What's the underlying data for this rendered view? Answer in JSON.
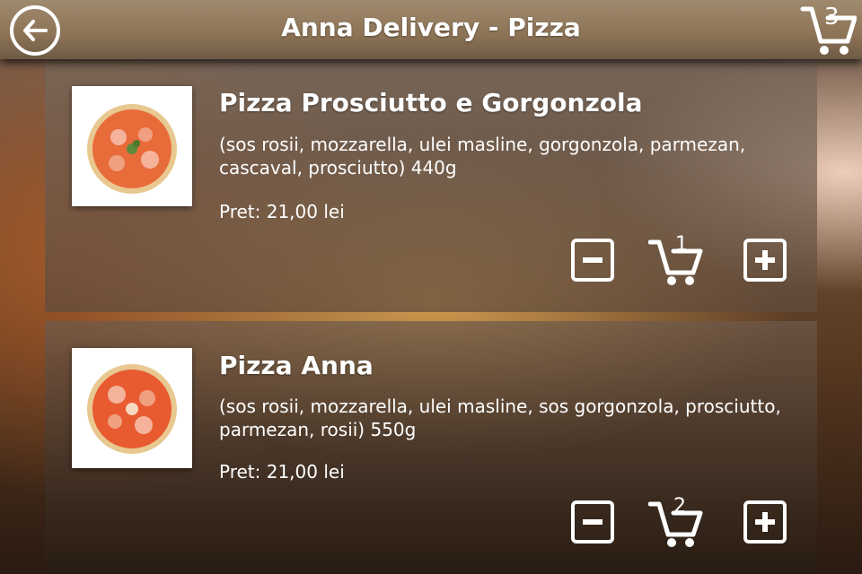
{
  "header": {
    "title": "Anna Delivery - Pizza",
    "back_icon": "back-arrow-icon",
    "cart_icon": "cart-icon",
    "cart_count": "3"
  },
  "products": [
    {
      "name": "Pizza Prosciutto e Gorgonzola",
      "description": "(sos rosii, mozzarella, ulei masline, gorgonzola, parmezan, cascaval, prosciutto) 440g",
      "price": "Pret: 21,00 lei",
      "quantity": "1"
    },
    {
      "name": "Pizza Anna",
      "description": "(sos rosii, mozzarella, ulei masline, sos gorgonzola, prosciutto, parmezan, rosii) 550g",
      "price": "Pret: 21,00 lei",
      "quantity": "2"
    }
  ],
  "colors": {
    "header": "#8c7356",
    "text": "#ffffff",
    "divider_glow": "#f0b45a"
  }
}
